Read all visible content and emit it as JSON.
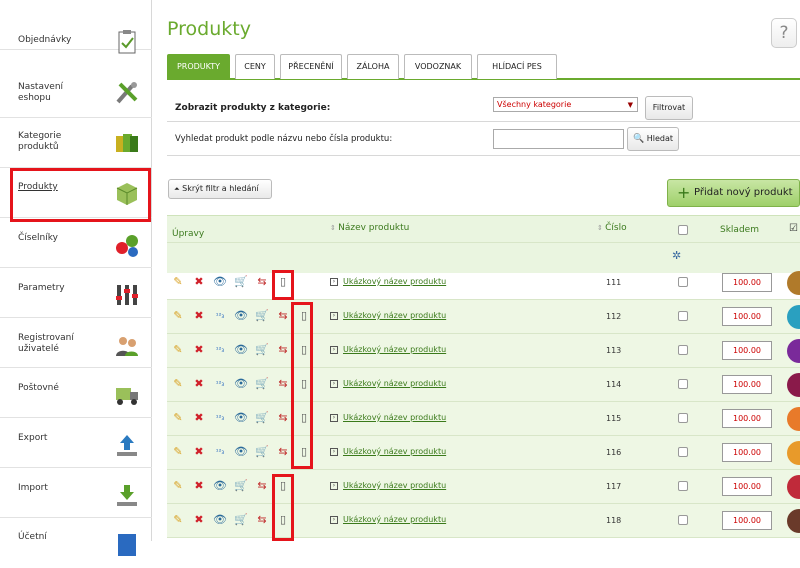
{
  "sidebar": {
    "items": [
      {
        "label": "Objednávky",
        "icon": "clipboard-icon"
      },
      {
        "label": "Nastavení\neshopu",
        "icon": "tools-icon"
      },
      {
        "label": "Kategorie\nproduktů",
        "icon": "folders-icon"
      },
      {
        "label": "Produkty",
        "icon": "box-icon",
        "active": true
      },
      {
        "label": "Číselníky",
        "icon": "numbers-icon"
      },
      {
        "label": "Parametry",
        "icon": "sliders-icon"
      },
      {
        "label": "Registrovaní\nuživatelé",
        "icon": "users-icon"
      },
      {
        "label": "Poštovné",
        "icon": "truck-icon"
      },
      {
        "label": "Export",
        "icon": "upload-icon"
      },
      {
        "label": "Import",
        "icon": "download-icon"
      },
      {
        "label": "Účetní",
        "icon": "accounting-icon"
      }
    ]
  },
  "page": {
    "title": "Produkty",
    "help": "?"
  },
  "tabs": [
    "PRODUKTY",
    "CENY",
    "PŘECENĚNÍ",
    "ZÁLOHA",
    "VODOZNAK",
    "HLÍDACÍ PES"
  ],
  "filter": {
    "category_label": "Zobrazit produkty z kategorie:",
    "category_value": "Všechny kategorie",
    "filter_button": "Filtrovat",
    "search_label": "Vyhledat produkt podle názvu nebo čísla produktu:",
    "search_value": "",
    "search_button": "Hledat"
  },
  "toolbar": {
    "hide_filter": "Skrýt filtr a hledání",
    "add_product": "Přidat nový produkt"
  },
  "table": {
    "headers": {
      "actions": "Úpravy",
      "name": "Název produktu",
      "number": "Číslo",
      "stock": "Skladem"
    },
    "rows": [
      {
        "name": "Ukázkový název produktu",
        "number": "111",
        "stock": "100.00",
        "thumb_color": "#b07a2a"
      },
      {
        "name": "Ukázkový název produktu",
        "number": "112",
        "stock": "100.00",
        "thumb_color": "#2aa0c0"
      },
      {
        "name": "Ukázkový název produktu",
        "number": "113",
        "stock": "100.00",
        "thumb_color": "#7a2a9a"
      },
      {
        "name": "Ukázkový název produktu",
        "number": "114",
        "stock": "100.00",
        "thumb_color": "#8a1a4a"
      },
      {
        "name": "Ukázkový název produktu",
        "number": "115",
        "stock": "100.00",
        "thumb_color": "#e87a2a"
      },
      {
        "name": "Ukázkový název produktu",
        "number": "116",
        "stock": "100.00",
        "thumb_color": "#e89a2a"
      },
      {
        "name": "Ukázkový název produktu",
        "number": "117",
        "stock": "100.00",
        "thumb_color": "#c02a3a"
      },
      {
        "name": "Ukázkový název produktu",
        "number": "118",
        "stock": "100.00",
        "thumb_color": "#6a3a2a"
      }
    ]
  },
  "colors": {
    "accent": "#6aaa2e",
    "highlight": "#e5141b"
  }
}
